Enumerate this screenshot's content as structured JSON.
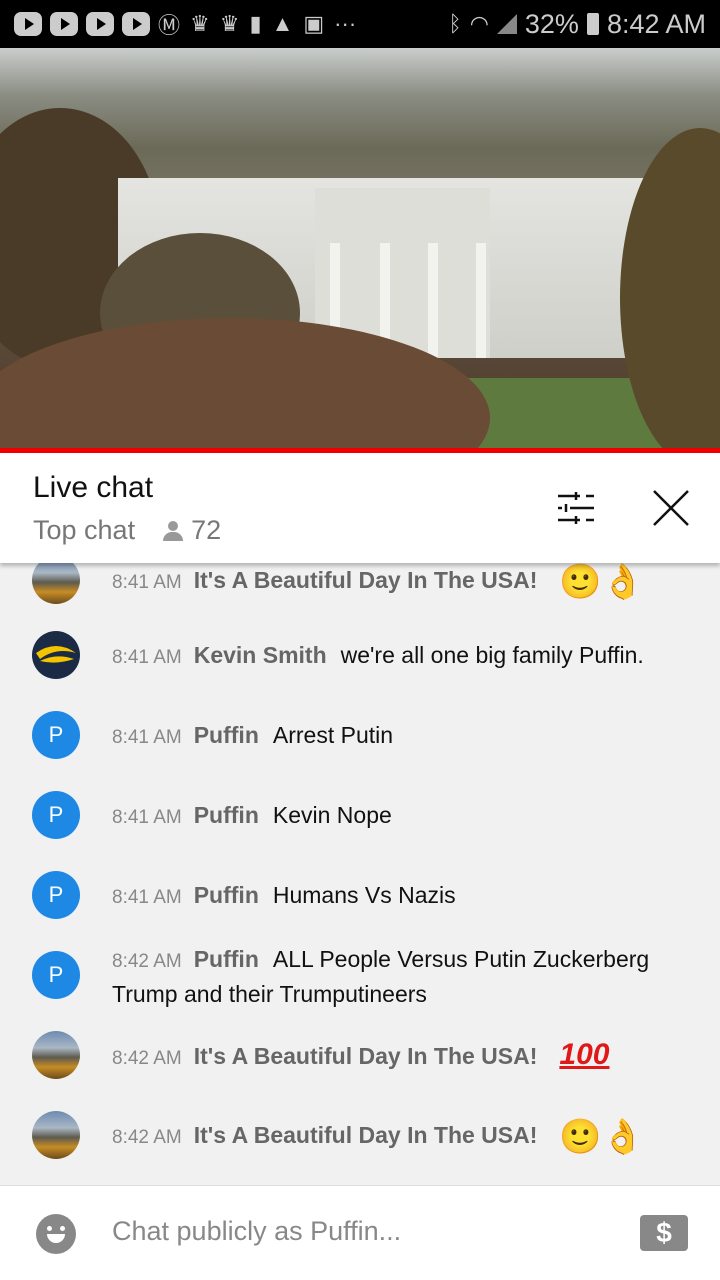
{
  "status_bar": {
    "battery": "32%",
    "time": "8:42 AM"
  },
  "header": {
    "title": "Live chat",
    "mode": "Top chat",
    "viewer_count": "72"
  },
  "messages": [
    {
      "time": "8:41 AM",
      "author": "It's A Beautiful Day In The USA!",
      "text": "",
      "emoji": "🙂👌",
      "avatar": "landscape"
    },
    {
      "time": "8:41 AM",
      "author": "Kevin Smith",
      "text": "we're all one big family Puffin.",
      "avatar": "logo"
    },
    {
      "time": "8:41 AM",
      "author": "Puffin",
      "text": "Arrest Putin",
      "avatar": "P"
    },
    {
      "time": "8:41 AM",
      "author": "Puffin",
      "text": "Kevin Nope",
      "avatar": "P"
    },
    {
      "time": "8:41 AM",
      "author": "Puffin",
      "text": "Humans Vs Nazis",
      "avatar": "P"
    },
    {
      "time": "8:42 AM",
      "author": "Puffin",
      "text": "ALL People Versus Putin Zuckerberg Trump and their Trumputineers",
      "avatar": "P"
    },
    {
      "time": "8:42 AM",
      "author": "It's A Beautiful Day In The USA!",
      "text": "",
      "emoji": "100",
      "avatar": "landscape"
    },
    {
      "time": "8:42 AM",
      "author": "It's A Beautiful Day In The USA!",
      "text": "",
      "emoji": "🙂👌",
      "avatar": "landscape"
    }
  ],
  "input": {
    "placeholder": "Chat publicly as Puffin...",
    "dollar_icon": "$"
  },
  "colors": {
    "progress": "#ee0000",
    "avatar_p": "#1e88e5"
  }
}
